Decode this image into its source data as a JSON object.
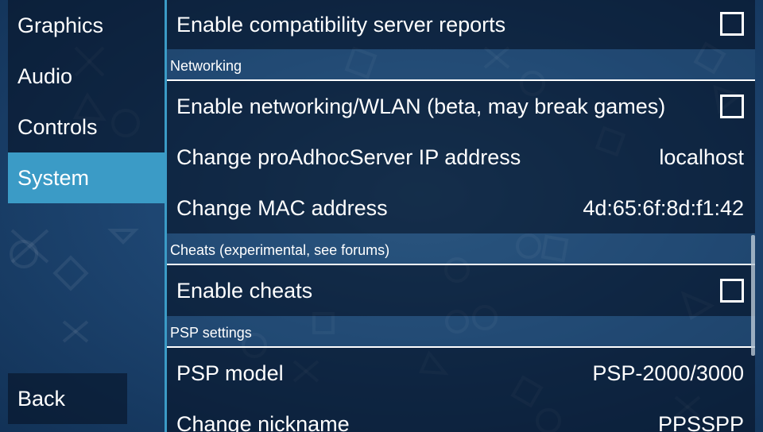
{
  "sidebar": {
    "items": [
      {
        "label": "Graphics"
      },
      {
        "label": "Audio"
      },
      {
        "label": "Controls"
      },
      {
        "label": "System"
      }
    ],
    "selected": "System",
    "back_label": "Back"
  },
  "settings": {
    "compat_reports": {
      "label": "Enable compatibility server reports",
      "checked": false
    },
    "networking": {
      "header": "Networking",
      "enable_networking": {
        "label": "Enable networking/WLAN (beta, may break games)",
        "checked": false
      },
      "adhoc_server": {
        "label": "Change proAdhocServer IP address",
        "value": "localhost"
      },
      "mac_address": {
        "label": "Change MAC address",
        "value": "4d:65:6f:8d:f1:42"
      }
    },
    "cheats": {
      "header": "Cheats (experimental, see forums)",
      "enable_cheats": {
        "label": "Enable cheats",
        "checked": false
      }
    },
    "psp": {
      "header": "PSP settings",
      "psp_model": {
        "label": "PSP model",
        "value": "PSP-2000/3000"
      },
      "nickname": {
        "label": "Change nickname",
        "value": "PPSSPP"
      }
    }
  },
  "colors": {
    "accent": "#3b9bc6",
    "background": "#1e4672",
    "row_background": "#0a1a2e",
    "text": "#ffffff"
  }
}
